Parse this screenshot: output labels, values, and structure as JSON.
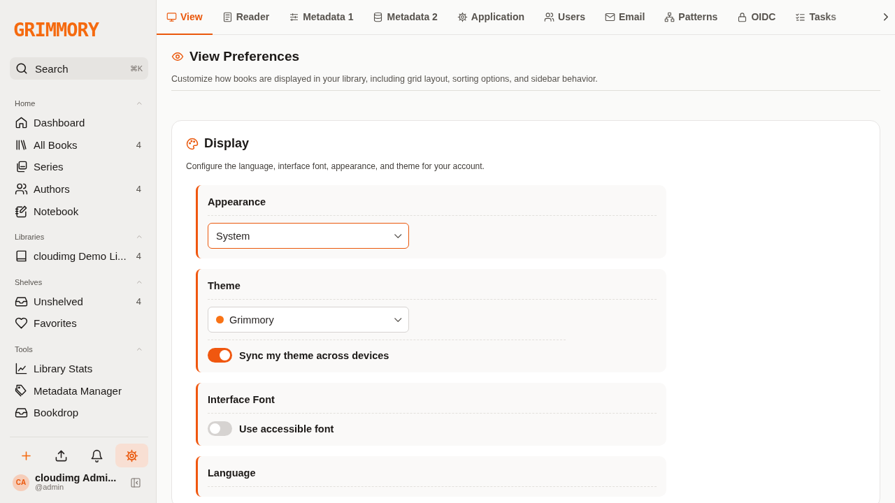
{
  "logo": {
    "text": "GRIMMORY"
  },
  "search": {
    "placeholder": "Search",
    "shortcut": "⌘K"
  },
  "sidebar": {
    "groups": [
      {
        "title": "Home",
        "expanded": true,
        "items": [
          {
            "label": "Dashboard"
          },
          {
            "label": "All Books",
            "count": "4"
          },
          {
            "label": "Series"
          },
          {
            "label": "Authors",
            "count": "4"
          },
          {
            "label": "Notebook"
          }
        ]
      },
      {
        "title": "Libraries",
        "expanded": true,
        "items": [
          {
            "label": "cloudimg Demo Li...",
            "count": "4"
          }
        ]
      },
      {
        "title": "Shelves",
        "expanded": true,
        "items": [
          {
            "label": "Unshelved",
            "count": "4"
          },
          {
            "label": "Favorites"
          }
        ]
      },
      {
        "title": "Tools",
        "expanded": true,
        "items": [
          {
            "label": "Library Stats"
          },
          {
            "label": "Metadata Manager"
          },
          {
            "label": "Bookdrop"
          }
        ]
      }
    ]
  },
  "actions": [
    {
      "selected": false
    },
    {
      "selected": false
    },
    {
      "selected": false
    },
    {
      "selected": true
    }
  ],
  "user": {
    "initials": "CA",
    "name": "cloudimg Admi...",
    "handle": "@admin"
  },
  "tabs": [
    {
      "label": "View",
      "selected": true
    },
    {
      "label": "Reader",
      "selected": false
    },
    {
      "label": "Metadata 1",
      "selected": false
    },
    {
      "label": "Metadata 2",
      "selected": false
    },
    {
      "label": "Application",
      "selected": false
    },
    {
      "label": "Users",
      "selected": false
    },
    {
      "label": "Email",
      "selected": false
    },
    {
      "label": "Patterns",
      "selected": false
    },
    {
      "label": "OIDC",
      "selected": false
    },
    {
      "label": "Tasks",
      "selected": false
    }
  ],
  "page": {
    "title": "View Preferences",
    "description": "Customize how books are displayed in your library, including grid layout, sorting options, and sidebar behavior."
  },
  "section": {
    "title": "Display",
    "description": "Configure the language, interface font, appearance, and theme for your account.",
    "groups": [
      {
        "title": "Appearance",
        "controls": [
          {
            "kind": "select",
            "value": "System",
            "focused": true
          }
        ]
      },
      {
        "title": "Theme",
        "controls": [
          {
            "kind": "select",
            "value": "Grimmory",
            "color": "#f97316",
            "focused": false
          },
          {
            "kind": "toggle",
            "label": "Sync my theme across devices",
            "on": true
          }
        ]
      },
      {
        "title": "Interface Font",
        "controls": [
          {
            "kind": "toggle",
            "label": "Use accessible font",
            "on": false
          }
        ]
      },
      {
        "title": "Language"
      }
    ]
  }
}
